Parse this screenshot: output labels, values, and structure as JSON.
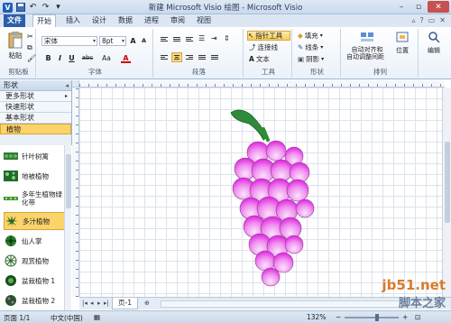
{
  "window": {
    "title": "新建 Microsoft Visio 绘图 - Microsoft Visio"
  },
  "tabs": [
    {
      "label": "文件"
    },
    {
      "label": "开始"
    },
    {
      "label": "插入"
    },
    {
      "label": "设计"
    },
    {
      "label": "数据"
    },
    {
      "label": "进程"
    },
    {
      "label": "审阅"
    },
    {
      "label": "视图"
    }
  ],
  "ribbon": {
    "clipboard": {
      "paste_label": "粘贴",
      "group_label": "剪贴板"
    },
    "font": {
      "font_name": "宋体",
      "font_size": "8pt",
      "group_label": "字体",
      "bold": "B",
      "italic": "I",
      "underline": "U",
      "abc": "abc",
      "aa": "Aa",
      "grow": "A",
      "shrink": "A"
    },
    "paragraph": {
      "group_label": "段落"
    },
    "tools": {
      "pointer_label": "指针工具",
      "connector_label": "连接线",
      "text_label": "文本",
      "group_label": "工具"
    },
    "shape": {
      "fill_label": "填充",
      "line_label": "线条",
      "shadow_label": "阴影",
      "group_label": "形状"
    },
    "arrange": {
      "auto_align_label": "自动对齐和",
      "auto_space_label": "自动调整间距",
      "position_label": "位置",
      "group_label": "排列"
    },
    "editing": {
      "edit_label": "编辑"
    }
  },
  "shapes_panel": {
    "header": "形状",
    "rows": [
      {
        "label": "更多形状"
      },
      {
        "label": "快速形状"
      },
      {
        "label": "基本形状"
      },
      {
        "label": "植物"
      }
    ],
    "stencil_items": [
      {
        "label": "针叶树篱"
      },
      {
        "label": "地被植物"
      },
      {
        "label": "多年生植物绿化带"
      },
      {
        "label": "多汁植物"
      },
      {
        "label": "仙人掌"
      },
      {
        "label": "观赏植物"
      },
      {
        "label": "盆栽植物 1"
      },
      {
        "label": "盆栽植物 2"
      }
    ]
  },
  "page_bar": {
    "page_tab": "页-1"
  },
  "status_bar": {
    "page_info": "页面 1/1",
    "language": "中文(中国)",
    "zoom": "132%"
  },
  "watermark": {
    "line1": "jb51.net",
    "line2": "脚本之家"
  },
  "colors": {
    "file_tab": "#2b5fac",
    "grape_fill": "#ee22ee",
    "stem": "#2e8b3a",
    "selected": "#fbd36b"
  }
}
